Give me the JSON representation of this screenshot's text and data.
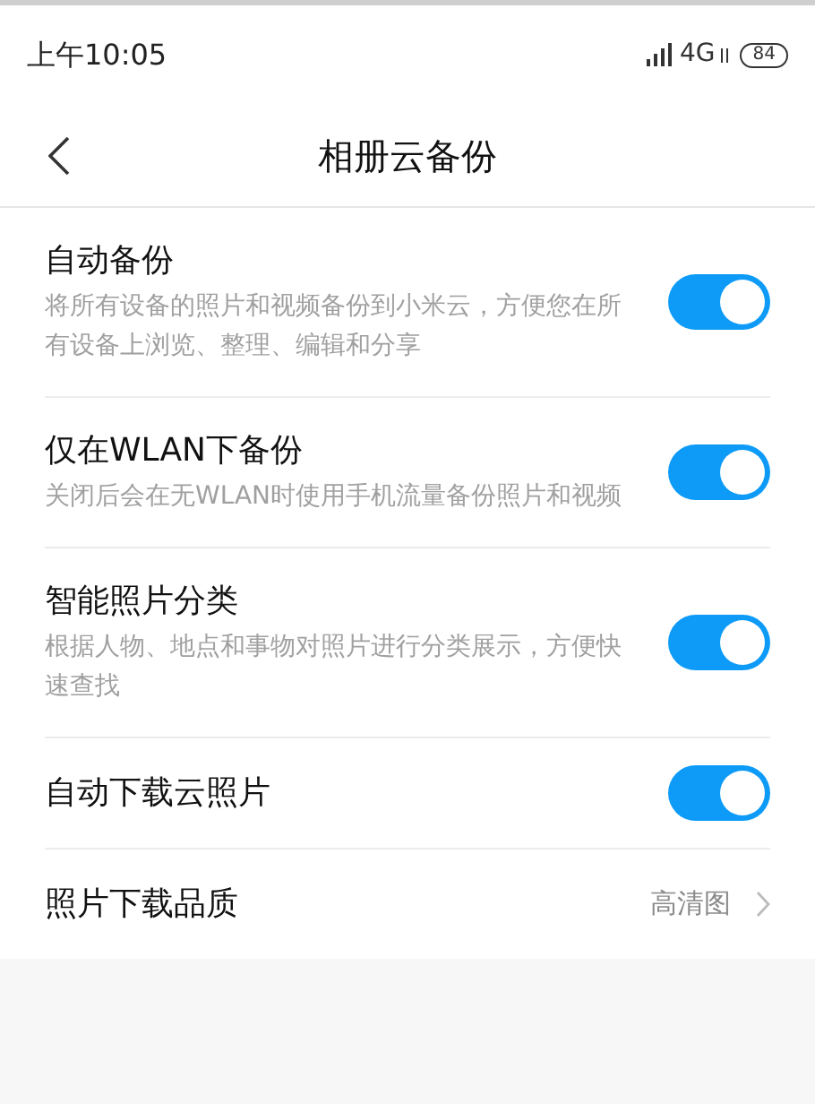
{
  "status_bar": {
    "time": "上午10:05",
    "network": "4G",
    "battery": "84"
  },
  "header": {
    "title": "相册云备份"
  },
  "settings": [
    {
      "kind": "toggle",
      "title": "自动备份",
      "description": "将所有设备的照片和视频备份到小米云，方便您在所有设备上浏览、整理、编辑和分享",
      "on": true
    },
    {
      "kind": "toggle",
      "title": "仅在WLAN下备份",
      "description": "关闭后会在无WLAN时使用手机流量备份照片和视频",
      "on": true
    },
    {
      "kind": "toggle",
      "title": "智能照片分类",
      "description": "根据人物、地点和事物对照片进行分类展示，方便快速查找",
      "on": true
    },
    {
      "kind": "toggle",
      "title": "自动下载云照片",
      "on": true
    },
    {
      "kind": "value",
      "title": "照片下载品质",
      "value": "高清图"
    }
  ]
}
